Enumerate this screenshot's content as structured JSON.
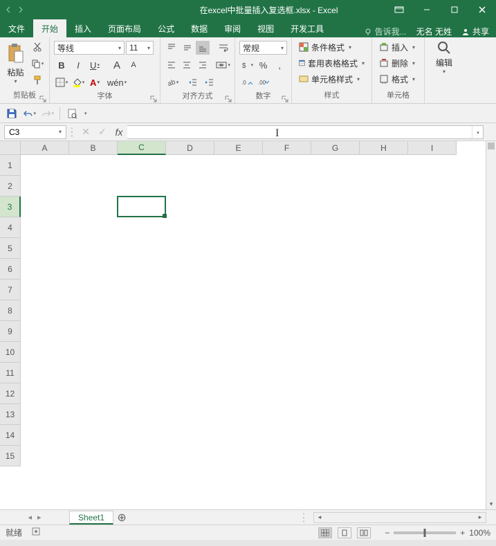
{
  "app": {
    "title": "在excel中批量插入复选框.xlsx - Excel",
    "user": "无名 无姓",
    "share": "共享",
    "tell_me": "告诉我..."
  },
  "tabs": {
    "file": "文件",
    "home": "开始",
    "insert": "插入",
    "layout": "页面布局",
    "formulas": "公式",
    "data": "数据",
    "review": "审阅",
    "view": "视图",
    "dev": "开发工具"
  },
  "ribbon": {
    "clipboard": {
      "label": "剪贴板",
      "paste": "粘贴"
    },
    "font": {
      "label": "字体",
      "name": "等线",
      "size": "11",
      "bold": "B",
      "italic": "I",
      "underline": "U",
      "aup": "A",
      "adn": "A",
      "wen": "wén"
    },
    "align": {
      "label": "对齐方式"
    },
    "number": {
      "label": "数字",
      "format": "常规"
    },
    "styles": {
      "label": "样式",
      "cond": "条件格式",
      "table": "套用表格格式",
      "cell": "单元格样式"
    },
    "cells": {
      "label": "单元格",
      "insert": "插入",
      "delete": "删除",
      "format": "格式"
    },
    "editing": {
      "label": "编辑"
    }
  },
  "formula_bar": {
    "ref": "C3"
  },
  "grid": {
    "cols": [
      "A",
      "B",
      "C",
      "D",
      "E",
      "F",
      "G",
      "H",
      "I"
    ],
    "rows": [
      "1",
      "2",
      "3",
      "4",
      "5",
      "6",
      "7",
      "8",
      "9",
      "10",
      "11",
      "12",
      "13",
      "14",
      "15"
    ],
    "active_col": "C",
    "active_row": "3"
  },
  "sheet": {
    "name": "Sheet1"
  },
  "status": {
    "ready": "就绪",
    "rec": "",
    "zoom": "100%",
    "minus": "−",
    "plus": "+"
  }
}
